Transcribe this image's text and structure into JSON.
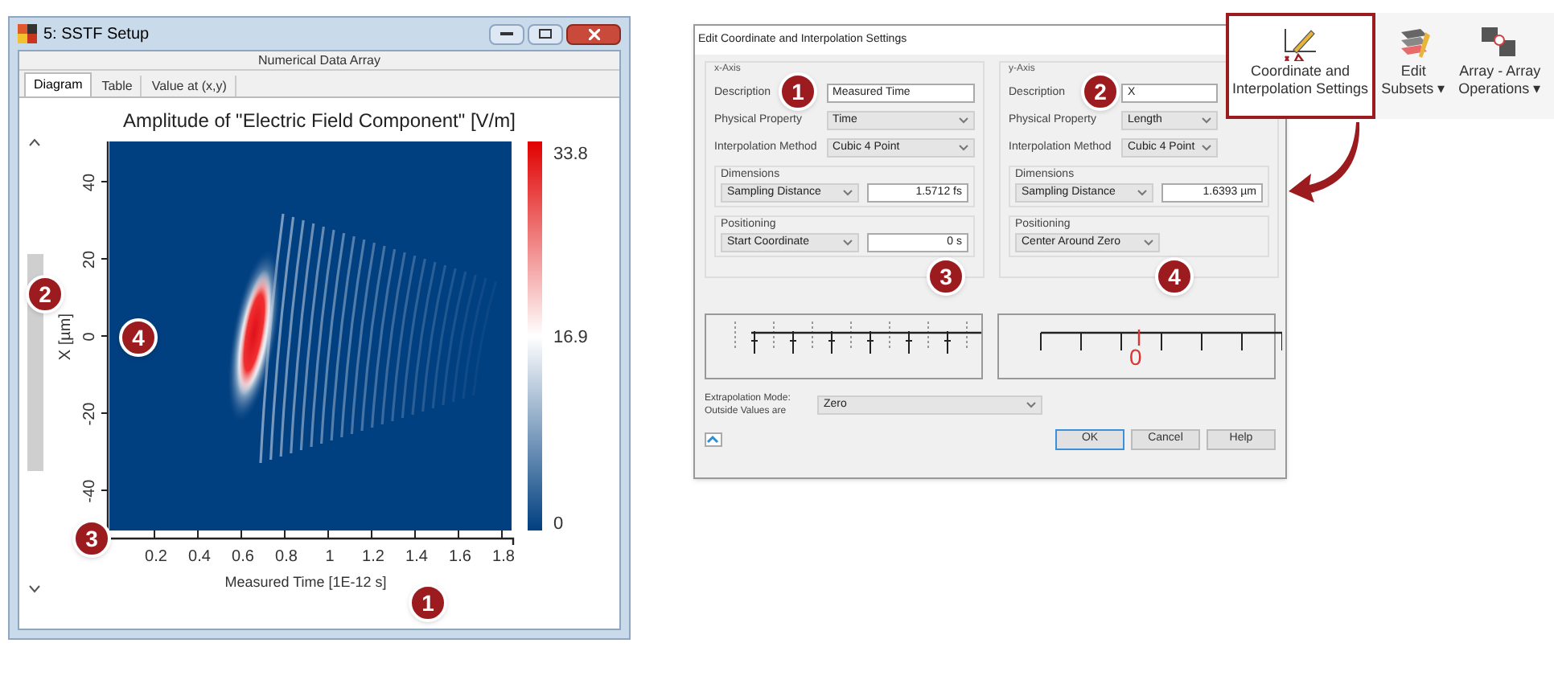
{
  "window": {
    "title": "5: SSTF Setup",
    "header": "Numerical Data Array",
    "tabs": [
      {
        "label": "Diagram",
        "selected": true
      },
      {
        "label": "Table",
        "selected": false
      },
      {
        "label": "Value at (x,y)",
        "selected": false
      }
    ],
    "plot": {
      "title": "Amplitude of \"Electric Field Component\"  [V/m]",
      "xlabel": "Measured Time [1E-12 s]",
      "ylabel": "X [µm]",
      "xticks": [
        "0.2",
        "0.4",
        "0.6",
        "0.8",
        "1",
        "1.2",
        "1.4",
        "1.6",
        "1.8"
      ],
      "yticks": [
        "40",
        "20",
        "0",
        "-20",
        "-40"
      ],
      "colorbar": [
        "33.8",
        "16.9",
        "0"
      ]
    },
    "callouts": [
      "1",
      "2",
      "3",
      "4"
    ]
  },
  "dialog": {
    "title": "Edit Coordinate and Interpolation Settings",
    "axes": [
      {
        "title": "x-Axis",
        "description_label": "Description",
        "description": "Measured Time",
        "fields": [
          {
            "label": "Physical Property",
            "value": "Time"
          },
          {
            "label": "Interpolation Method",
            "value": "Cubic 4 Point"
          }
        ],
        "dimensions": {
          "title": "Dimensions",
          "mode": "Sampling Distance",
          "value": "1.5712 fs"
        },
        "positioning": {
          "title": "Positioning",
          "mode": "Start Coordinate",
          "value": "0 s"
        }
      },
      {
        "title": "y-Axis",
        "description_label": "Description",
        "description": "X",
        "fields": [
          {
            "label": "Physical Property",
            "value": "Length"
          },
          {
            "label": "Interpolation Method",
            "value": "Cubic 4 Point"
          }
        ],
        "dimensions": {
          "title": "Dimensions",
          "mode": "Sampling Distance",
          "value": "1.6393 µm"
        },
        "positioning": {
          "title": "Positioning",
          "mode": "Center Around Zero"
        }
      }
    ],
    "previews": [
      {
        "kind": "start"
      },
      {
        "kind": "centered",
        "label": "0"
      }
    ],
    "extrapolation": {
      "label_lines": [
        "Extrapolation Mode:",
        "Outside Values are"
      ],
      "value": "Zero"
    },
    "buttons": [
      {
        "label": "OK",
        "default": true
      },
      {
        "label": "Cancel",
        "default": false
      },
      {
        "label": "Help",
        "default": false
      }
    ],
    "callouts": [
      "1",
      "2",
      "3",
      "4"
    ]
  },
  "ribbon": [
    {
      "kind": "coordinates",
      "lines": [
        "Coordinate and",
        "Interpolation Settings"
      ],
      "selected": true
    },
    {
      "kind": "subsets",
      "lines": [
        "Edit",
        "Subsets ▾"
      ],
      "selected": false
    },
    {
      "kind": "operations",
      "lines": [
        "Array - Array",
        "Operations ▾"
      ],
      "selected": false
    }
  ]
}
